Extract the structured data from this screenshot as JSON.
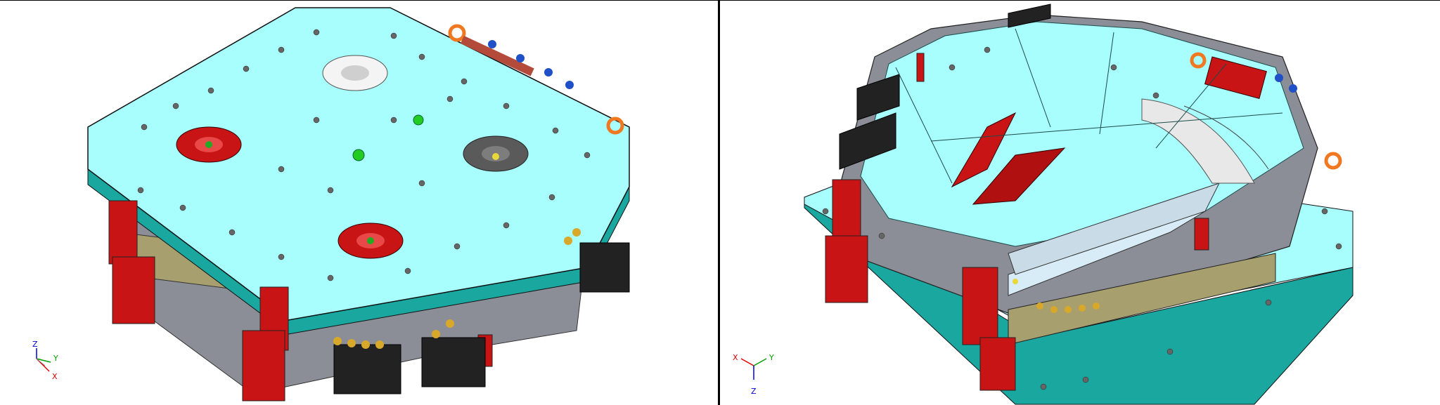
{
  "viewports": [
    {
      "name": "left",
      "triad": {
        "z": "Z",
        "y": "Y",
        "x": "X"
      }
    },
    {
      "name": "right",
      "triad": {
        "x": "X",
        "y": "Y",
        "z": "Z"
      }
    }
  ],
  "colors": {
    "plate": "#a8fdfd",
    "plate_edge": "#1aa7a0",
    "clamp_red": "#c81414",
    "body_grey": "#8b8e97",
    "tan_band": "#a89f6f",
    "brass": "#d8a82a",
    "axis_x": "#e00000",
    "axis_y": "#00a000",
    "axis_z": "#0000e0"
  },
  "icons": [
    "axis-triad-icon",
    "axis-triad-icon"
  ]
}
